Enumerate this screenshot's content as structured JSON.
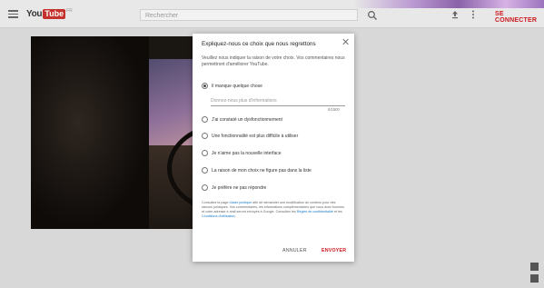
{
  "header": {
    "logo_you": "You",
    "logo_tube": "Tube",
    "logo_country": "FR",
    "search_placeholder": "Rechercher",
    "signin_label": "SE CONNECTER"
  },
  "icons": [
    "menu-icon",
    "search-icon",
    "upload-icon",
    "more-vert-icon",
    "close-icon",
    "feedback-icon",
    "help-icon"
  ],
  "dialog": {
    "title": "Expliquez-nous ce choix que nous regrettons",
    "description": "Veuillez nous indiquer la raison de votre choix. Vos commentaires nous permettront d'améliorer YouTube.",
    "options": [
      "Il manque quelque chose",
      "J'ai constaté un dysfonctionnement",
      "Une fonctionnalité est plus difficile à utiliser",
      "Je n'aime pas la nouvelle interface",
      "La raison de mon choix ne figure pas dans la liste",
      "Je préfère ne pas répondre"
    ],
    "selected_index": 0,
    "more_info_placeholder": "Donnez-nous plus d'informations",
    "counter": "0/1500",
    "legal": {
      "part1": "Consultez la page ",
      "link1": "d'aide juridique",
      "part2": " afin de demander une modification du contenu pour des raisons juridiques. Vos commentaires, les informations complémentaires que vous avez fournies et votre adresse e-mail seront envoyés à Google. Consultez les ",
      "link2": "Règles de confidentialité",
      "part3": " et les ",
      "link3": "Conditions d'utilisation",
      "part4": "."
    },
    "cancel_label": "ANNULER",
    "send_label": "ENVOYER"
  },
  "colors": {
    "brand_red": "#cc181e",
    "link_blue": "#167ac6",
    "topbar_bg": "#e8e8e8"
  }
}
